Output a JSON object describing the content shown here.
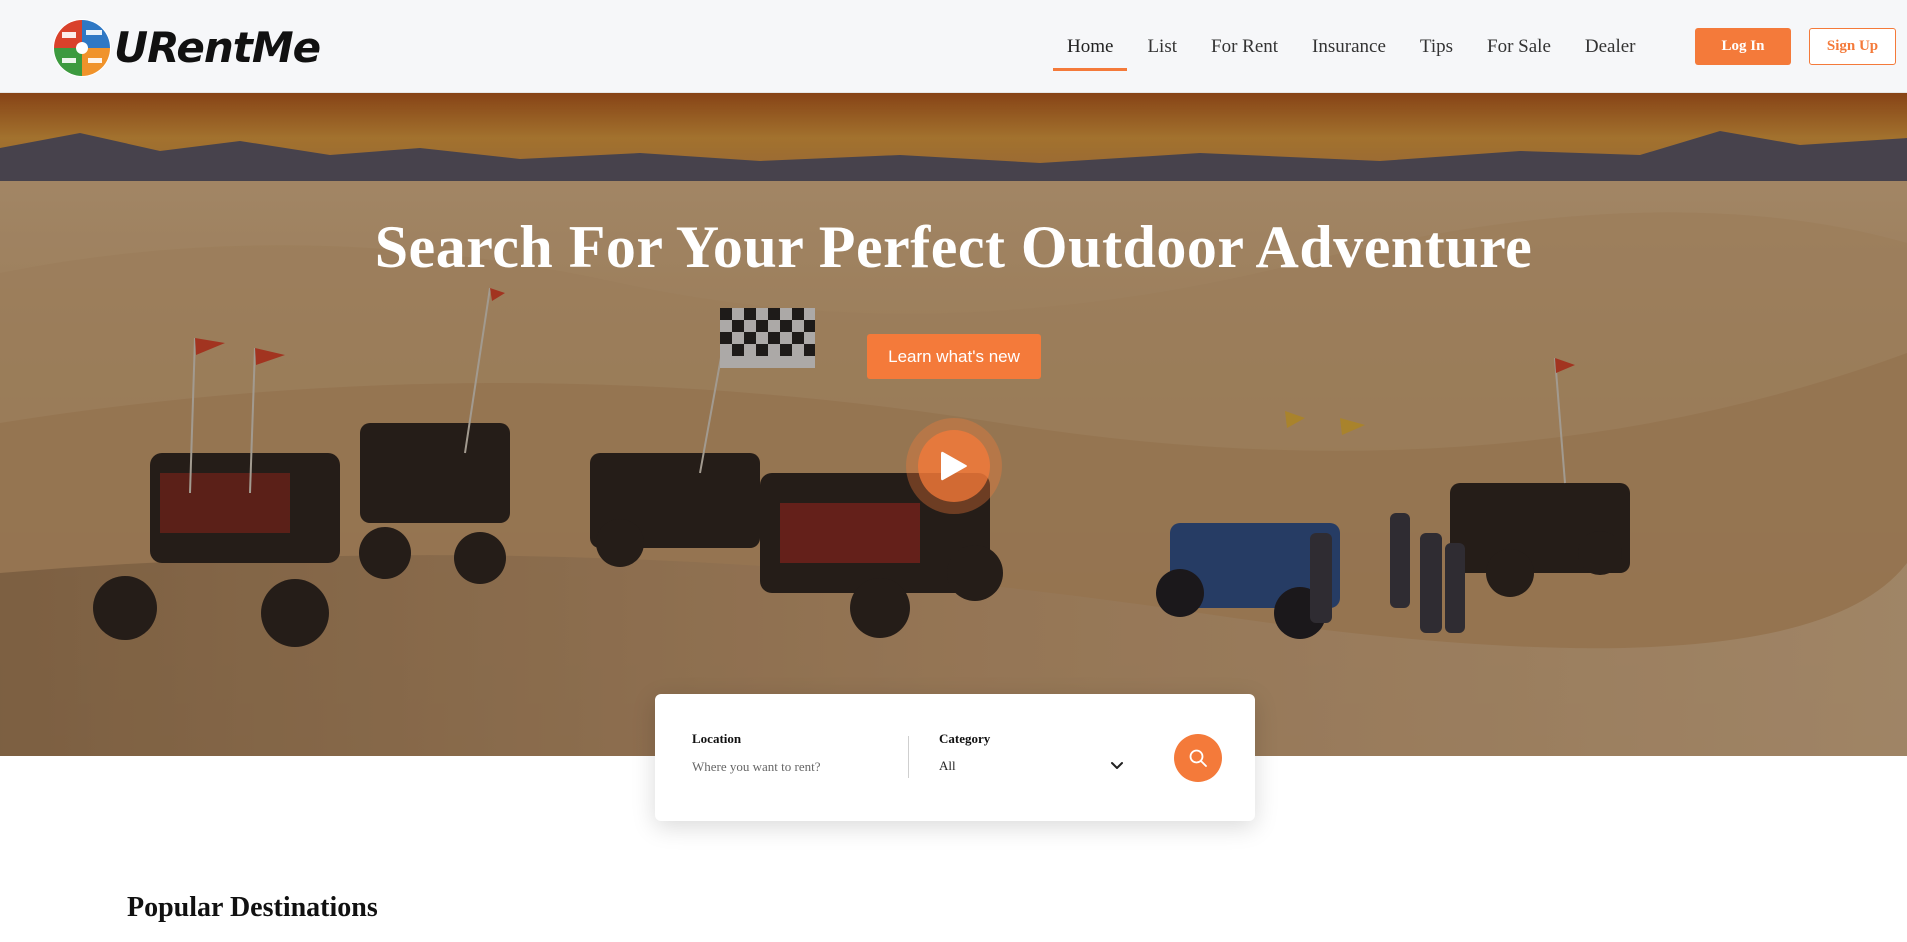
{
  "brand": {
    "name": "URentMe"
  },
  "nav": {
    "items": [
      {
        "label": "Home",
        "active": true
      },
      {
        "label": "List",
        "active": false
      },
      {
        "label": "For Rent",
        "active": false
      },
      {
        "label": "Insurance",
        "active": false
      },
      {
        "label": "Tips",
        "active": false
      },
      {
        "label": "For Sale",
        "active": false
      },
      {
        "label": "Dealer",
        "active": false
      }
    ],
    "login_label": "Log In",
    "signup_label": "Sign Up"
  },
  "hero": {
    "title": "Search For Your Perfect Outdoor Adventure",
    "cta_label": "Learn what's new",
    "play_icon": "play-icon"
  },
  "search": {
    "location_label": "Location",
    "location_placeholder": "Where you want to rent?",
    "location_value": "",
    "category_label": "Category",
    "category_value": "All",
    "search_icon": "search-icon"
  },
  "sections": {
    "popular_title": "Popular Destinations"
  },
  "colors": {
    "accent": "#f47a3a",
    "header_bg": "#f6f7f9"
  }
}
